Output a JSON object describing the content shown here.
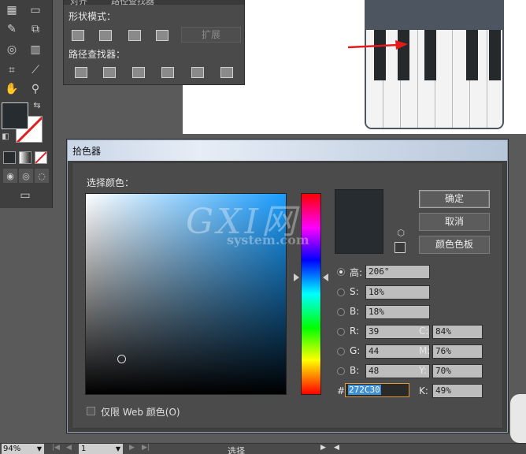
{
  "pathfinder_panel": {
    "tab_align": "对齐",
    "tab_pathfinder": "路径查找器",
    "shape_modes_label": "形状模式：",
    "expand_label": "扩展",
    "pathfinders_label": "路径查找器："
  },
  "toolbar": {
    "fill_color": "#272C30",
    "stroke_color": "none"
  },
  "dialog": {
    "title": "拾色器",
    "select_color_label": "选择颜色：",
    "ok_label": "确定",
    "cancel_label": "取消",
    "swatches_label": "颜色色板",
    "selected_mode": "H",
    "fields": {
      "h_label": "高:",
      "h_value": "206°",
      "s_label": "S:",
      "s_value": "18%",
      "b_label": "B:",
      "b_value": "18%",
      "r_label": "R:",
      "r_value": "39",
      "g_label": "G:",
      "g_value": "44",
      "bb_label": "B:",
      "bb_value": "48",
      "c_label": "C:",
      "c_value": "84%",
      "m_label": "M:",
      "m_value": "76%",
      "y_label": "Y:",
      "y_value": "70%",
      "k_label": "K:",
      "k_value": "49%",
      "hex_label": "#",
      "hex_value": "272C30"
    },
    "web_only_label": "仅限 Web 颜色(O)",
    "web_only_checked": false,
    "current_color": "#272C30"
  },
  "watermark": {
    "main": "GXI网",
    "sub": "system.com"
  },
  "statusbar": {
    "zoom": "94%",
    "page": "1",
    "mode": "选择"
  }
}
